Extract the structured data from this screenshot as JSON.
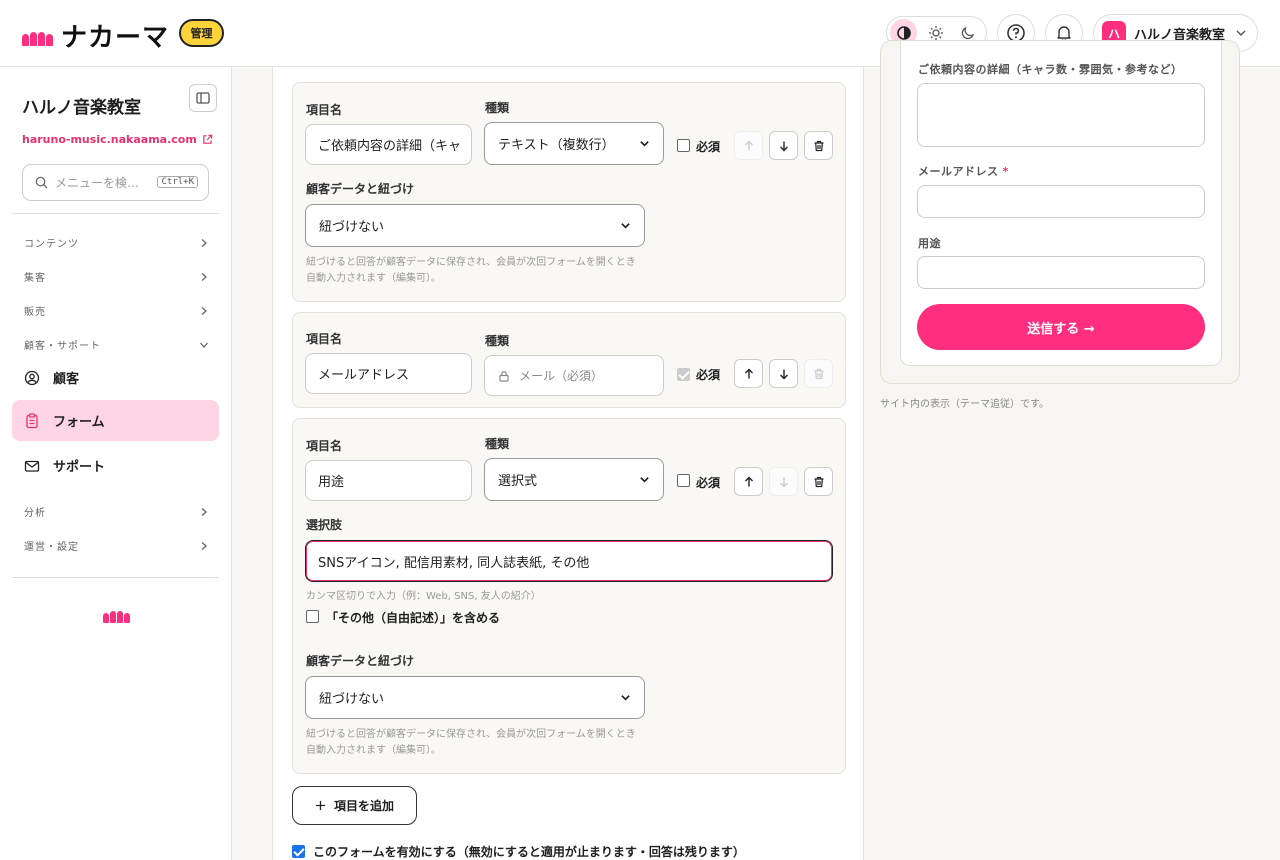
{
  "header": {
    "logo_text": "ナカーマ",
    "admin_badge": "管理",
    "account_initial": "ハ",
    "account_name": "ハルノ音楽教室"
  },
  "sidebar": {
    "title": "ハルノ音楽教室",
    "url": "haruno-music.nakaama.com",
    "search_placeholder": "メニューを検…",
    "search_shortcut": "Ctrl+K",
    "sections": {
      "content": "コンテンツ",
      "attract": "集客",
      "sales": "販売",
      "customer_support": "顧客・サポート",
      "analytics": "分析",
      "operations": "運営・設定"
    },
    "items": {
      "customers": "顧客",
      "forms": "フォーム",
      "support": "サポート"
    }
  },
  "builder": {
    "labels": {
      "item_name": "項目名",
      "type": "種類",
      "required": "必須",
      "link_customer": "顧客データと紐づけ",
      "choices": "選択肢"
    },
    "fields": [
      {
        "name_value": "ご依頼内容の詳細（キャ",
        "type_value": "テキスト（複数行）",
        "required": false,
        "link_value": "紐づけない",
        "link_help": "紐づけると回答が顧客データに保存され、会員が次回フォームを開くとき自動入力されます（編集可）。"
      },
      {
        "name_value": "メールアドレス",
        "type_value": "メール（必須）",
        "required": true
      },
      {
        "name_value": "用途",
        "type_value": "選択式",
        "required": false,
        "choices_value": "SNSアイコン, 配信用素材, 同人誌表紙, その他",
        "choices_help": "カンマ区切りで入力（例：Web, SNS, 友人の紹介）",
        "include_other_label": "「その他（自由記述）」を含める",
        "link_value": "紐づけない",
        "link_help": "紐づけると回答が顧客データに保存され、会員が次回フォームを開くとき自動入力されます（編集可）。"
      }
    ],
    "add_item_label": "項目を追加",
    "enable_label": "このフォームを有効にする（無効にすると適用が止まります・回答は残ります）"
  },
  "preview": {
    "cut_label": "ご依頼内容の詳細（キャラ数・雰囲気・参考など）",
    "email_label": "メールアドレス",
    "email_required_mark": "*",
    "purpose_label": "用途",
    "submit_label": "送信する →",
    "note": "サイト内の表示（テーマ追従）です。"
  },
  "colors": {
    "accent": "#ff2e7e",
    "accent_soft": "#ffd5e6",
    "badge": "#ffd43b"
  }
}
